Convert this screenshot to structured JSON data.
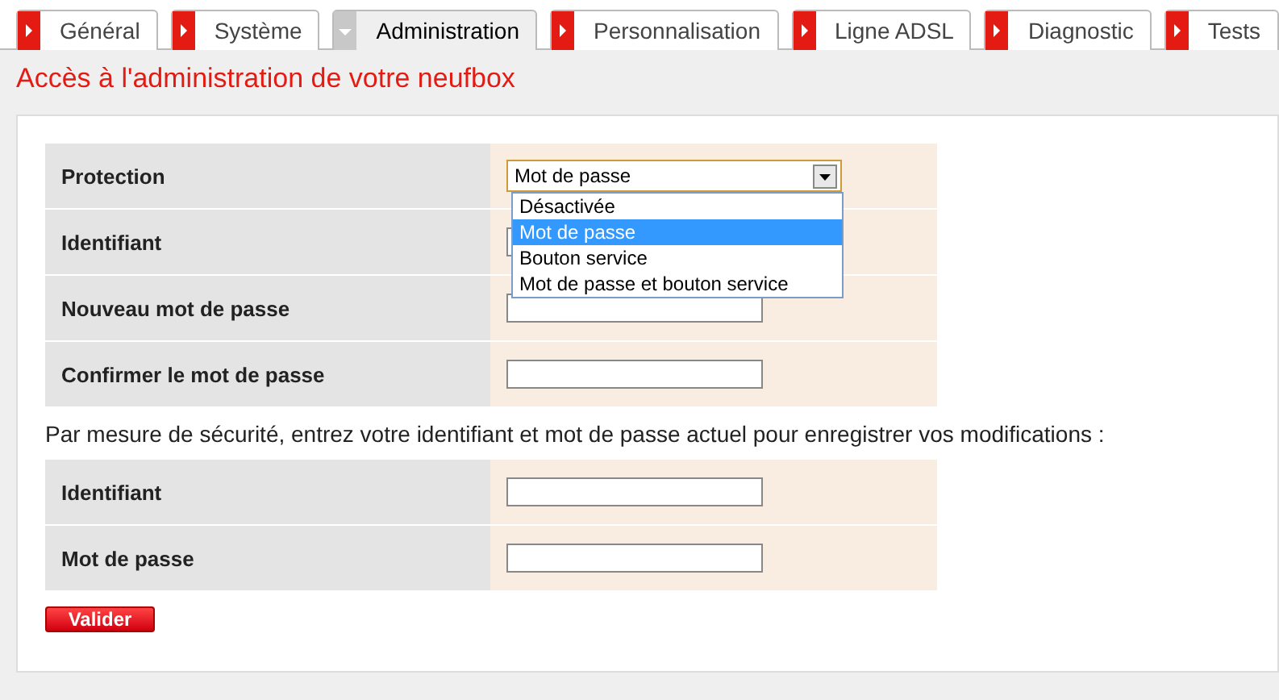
{
  "tabs": [
    {
      "label": "Général",
      "selected": false
    },
    {
      "label": "Système",
      "selected": false
    },
    {
      "label": "Administration",
      "selected": true
    },
    {
      "label": "Personnalisation",
      "selected": false
    },
    {
      "label": "Ligne ADSL",
      "selected": false
    },
    {
      "label": "Diagnostic",
      "selected": false
    },
    {
      "label": "Tests",
      "selected": false
    }
  ],
  "page_title": "Accès à l'administration de votre neufbox",
  "settings": [
    {
      "label": "Protection",
      "kind": "select",
      "value": "Mot de passe",
      "expanded": true,
      "options": [
        {
          "label": "Désactivée",
          "selected": false
        },
        {
          "label": "Mot de passe",
          "selected": true
        },
        {
          "label": "Bouton service",
          "selected": false
        },
        {
          "label": "Mot de passe et bouton service",
          "selected": false
        }
      ]
    },
    {
      "label": "Identifiant",
      "kind": "text"
    },
    {
      "label": "Nouveau mot de passe",
      "kind": "text"
    },
    {
      "label": "Confirmer le mot de passe",
      "kind": "text"
    }
  ],
  "security_note": "Par mesure de sécurité, entrez votre identifiant et mot de passe actuel pour enregistrer vos modifications :",
  "credentials": [
    {
      "label": "Identifiant",
      "kind": "text"
    },
    {
      "label": "Mot de passe",
      "kind": "text"
    }
  ],
  "submit_button": "Valider"
}
